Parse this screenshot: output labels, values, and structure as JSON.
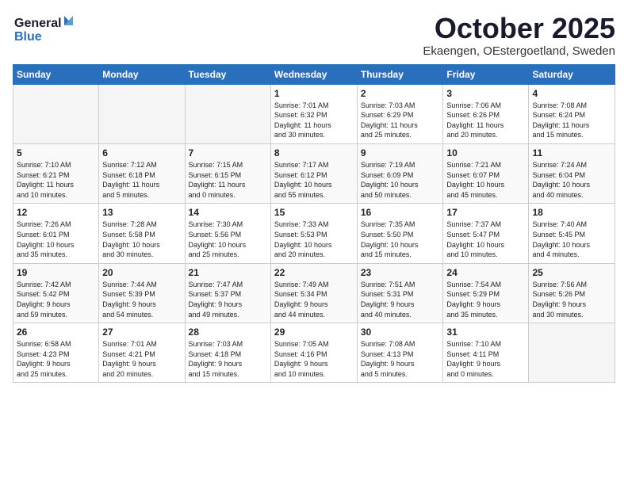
{
  "header": {
    "logo_line1": "General",
    "logo_line2": "Blue",
    "month_title": "October 2025",
    "location": "Ekaengen, OEstergoetland, Sweden"
  },
  "weekdays": [
    "Sunday",
    "Monday",
    "Tuesday",
    "Wednesday",
    "Thursday",
    "Friday",
    "Saturday"
  ],
  "weeks": [
    [
      {
        "day": "",
        "info": ""
      },
      {
        "day": "",
        "info": ""
      },
      {
        "day": "",
        "info": ""
      },
      {
        "day": "1",
        "info": "Sunrise: 7:01 AM\nSunset: 6:32 PM\nDaylight: 11 hours\nand 30 minutes."
      },
      {
        "day": "2",
        "info": "Sunrise: 7:03 AM\nSunset: 6:29 PM\nDaylight: 11 hours\nand 25 minutes."
      },
      {
        "day": "3",
        "info": "Sunrise: 7:06 AM\nSunset: 6:26 PM\nDaylight: 11 hours\nand 20 minutes."
      },
      {
        "day": "4",
        "info": "Sunrise: 7:08 AM\nSunset: 6:24 PM\nDaylight: 11 hours\nand 15 minutes."
      }
    ],
    [
      {
        "day": "5",
        "info": "Sunrise: 7:10 AM\nSunset: 6:21 PM\nDaylight: 11 hours\nand 10 minutes."
      },
      {
        "day": "6",
        "info": "Sunrise: 7:12 AM\nSunset: 6:18 PM\nDaylight: 11 hours\nand 5 minutes."
      },
      {
        "day": "7",
        "info": "Sunrise: 7:15 AM\nSunset: 6:15 PM\nDaylight: 11 hours\nand 0 minutes."
      },
      {
        "day": "8",
        "info": "Sunrise: 7:17 AM\nSunset: 6:12 PM\nDaylight: 10 hours\nand 55 minutes."
      },
      {
        "day": "9",
        "info": "Sunrise: 7:19 AM\nSunset: 6:09 PM\nDaylight: 10 hours\nand 50 minutes."
      },
      {
        "day": "10",
        "info": "Sunrise: 7:21 AM\nSunset: 6:07 PM\nDaylight: 10 hours\nand 45 minutes."
      },
      {
        "day": "11",
        "info": "Sunrise: 7:24 AM\nSunset: 6:04 PM\nDaylight: 10 hours\nand 40 minutes."
      }
    ],
    [
      {
        "day": "12",
        "info": "Sunrise: 7:26 AM\nSunset: 6:01 PM\nDaylight: 10 hours\nand 35 minutes."
      },
      {
        "day": "13",
        "info": "Sunrise: 7:28 AM\nSunset: 5:58 PM\nDaylight: 10 hours\nand 30 minutes."
      },
      {
        "day": "14",
        "info": "Sunrise: 7:30 AM\nSunset: 5:56 PM\nDaylight: 10 hours\nand 25 minutes."
      },
      {
        "day": "15",
        "info": "Sunrise: 7:33 AM\nSunset: 5:53 PM\nDaylight: 10 hours\nand 20 minutes."
      },
      {
        "day": "16",
        "info": "Sunrise: 7:35 AM\nSunset: 5:50 PM\nDaylight: 10 hours\nand 15 minutes."
      },
      {
        "day": "17",
        "info": "Sunrise: 7:37 AM\nSunset: 5:47 PM\nDaylight: 10 hours\nand 10 minutes."
      },
      {
        "day": "18",
        "info": "Sunrise: 7:40 AM\nSunset: 5:45 PM\nDaylight: 10 hours\nand 4 minutes."
      }
    ],
    [
      {
        "day": "19",
        "info": "Sunrise: 7:42 AM\nSunset: 5:42 PM\nDaylight: 9 hours\nand 59 minutes."
      },
      {
        "day": "20",
        "info": "Sunrise: 7:44 AM\nSunset: 5:39 PM\nDaylight: 9 hours\nand 54 minutes."
      },
      {
        "day": "21",
        "info": "Sunrise: 7:47 AM\nSunset: 5:37 PM\nDaylight: 9 hours\nand 49 minutes."
      },
      {
        "day": "22",
        "info": "Sunrise: 7:49 AM\nSunset: 5:34 PM\nDaylight: 9 hours\nand 44 minutes."
      },
      {
        "day": "23",
        "info": "Sunrise: 7:51 AM\nSunset: 5:31 PM\nDaylight: 9 hours\nand 40 minutes."
      },
      {
        "day": "24",
        "info": "Sunrise: 7:54 AM\nSunset: 5:29 PM\nDaylight: 9 hours\nand 35 minutes."
      },
      {
        "day": "25",
        "info": "Sunrise: 7:56 AM\nSunset: 5:26 PM\nDaylight: 9 hours\nand 30 minutes."
      }
    ],
    [
      {
        "day": "26",
        "info": "Sunrise: 6:58 AM\nSunset: 4:23 PM\nDaylight: 9 hours\nand 25 minutes."
      },
      {
        "day": "27",
        "info": "Sunrise: 7:01 AM\nSunset: 4:21 PM\nDaylight: 9 hours\nand 20 minutes."
      },
      {
        "day": "28",
        "info": "Sunrise: 7:03 AM\nSunset: 4:18 PM\nDaylight: 9 hours\nand 15 minutes."
      },
      {
        "day": "29",
        "info": "Sunrise: 7:05 AM\nSunset: 4:16 PM\nDaylight: 9 hours\nand 10 minutes."
      },
      {
        "day": "30",
        "info": "Sunrise: 7:08 AM\nSunset: 4:13 PM\nDaylight: 9 hours\nand 5 minutes."
      },
      {
        "day": "31",
        "info": "Sunrise: 7:10 AM\nSunset: 4:11 PM\nDaylight: 9 hours\nand 0 minutes."
      },
      {
        "day": "",
        "info": ""
      }
    ]
  ]
}
